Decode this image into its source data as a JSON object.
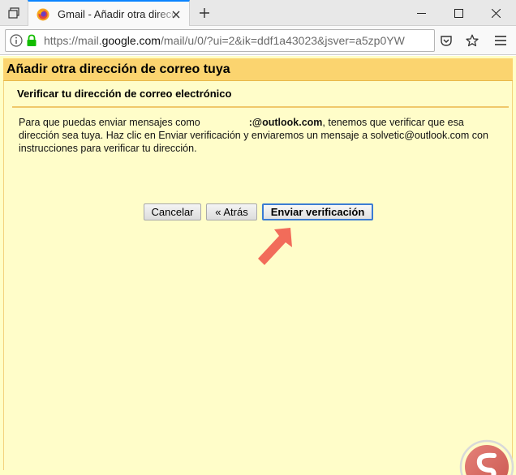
{
  "browser": {
    "tab": {
      "title": "Gmail - Añadir otra dirección de correo tuya"
    },
    "url": {
      "prefix": "https://mail.",
      "host": "google.com",
      "path": "/mail/u/0/?ui=2&ik=ddf1a43023&jsver=a5zp0YW"
    }
  },
  "dialog": {
    "header": "Añadir otra dirección de correo tuya",
    "section_title": "Verificar tu dirección de correo electrónico",
    "paragraph": {
      "part1": "Para que puedas enviar mensajes como",
      "email_bold": ":@outlook.com",
      "part2": ", tenemos que verificar que esa dirección sea tuya. Haz clic en Enviar verificación y enviaremos un mensaje a solvetic@outlook.com con instrucciones para verificar tu dirección."
    },
    "buttons": {
      "cancel": "Cancelar",
      "back": "« Atrás",
      "send": "Enviar verificación"
    }
  },
  "colors": {
    "header_bg": "#fbd46f",
    "body_bg": "#ffffc6",
    "arrow": "#f26c5a",
    "accent": "#0a84ff"
  },
  "icons": [
    "tab-list-icon",
    "firefox-icon",
    "close-icon",
    "plus-icon",
    "minimize-icon",
    "maximize-icon",
    "info-icon",
    "lock-icon",
    "pocket-icon",
    "star-icon",
    "hamburger-menu-icon",
    "arrow-icon",
    "solvetic-logo-icon"
  ]
}
